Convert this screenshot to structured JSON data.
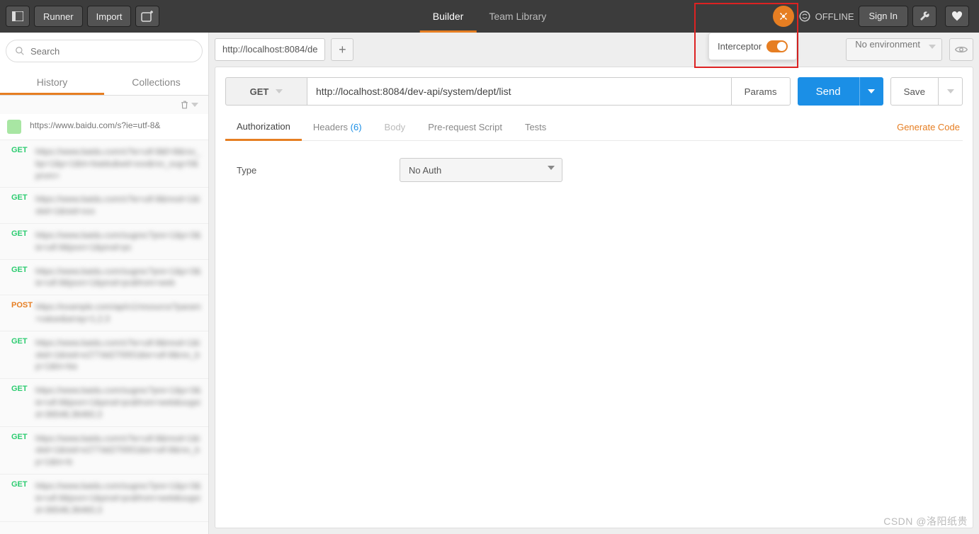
{
  "topbar": {
    "runner": "Runner",
    "import": "Import",
    "tabs": {
      "builder": "Builder",
      "teamlib": "Team Library"
    },
    "offline": "OFFLINE",
    "signin": "Sign In"
  },
  "popover": {
    "label": "Interceptor"
  },
  "sidebar": {
    "search_placeholder": "Search",
    "tabs": {
      "history": "History",
      "collections": "Collections"
    },
    "history": [
      {
        "method": "",
        "url": "https://www.baidu.com/s?ie=utf-8&"
      },
      {
        "method": "GET",
        "url": "https://www.baidu.com/s?ie=utf-8&f=8&rsv_bp=1&p=1&tn=baidu&wd=xxx&rsv_sug=0&prom="
      },
      {
        "method": "GET",
        "url": "https://www.baidu.com/s?ie=utf-8&mod=1&isbd=1&isid=xxx"
      },
      {
        "method": "GET",
        "url": "https://www.baidu.com/sugrec?pre=1&p=3&ie=utf-8&json=1&prod=pc"
      },
      {
        "method": "GET",
        "url": "https://www.baidu.com/sugrec?pre=1&p=3&ie=utf-8&json=1&prod=pc&from=web"
      },
      {
        "method": "POST",
        "url": "https://example.com/api/v1/resource?param=value&array=1,2,3"
      },
      {
        "method": "GET",
        "url": "https://www.baidu.com/s?ie=utf-8&mod=1&isbd=1&isid=e277dd270001&ie=utf-8&rsv_bp=1&tn=ba"
      },
      {
        "method": "GET",
        "url": "https://www.baidu.com/sugrec?pre=1&p=3&ie=utf-8&json=1&prod=pc&from=web&sugsid=36548,36460,3"
      },
      {
        "method": "GET",
        "url": "https://www.baidu.com/s?ie=utf-8&mod=1&isbd=1&isid=e277dd270001&ie=utf-8&rsv_bp=1&tn=b"
      },
      {
        "method": "GET",
        "url": "https://www.baidu.com/sugrec?pre=1&p=3&ie=utf-8&json=1&prod=pc&from=web&sugsid=36548,36460,3"
      }
    ]
  },
  "main": {
    "tab_label": "http://localhost:8084/de",
    "env_label": "No environment",
    "method": "GET",
    "url": "http://localhost:8084/dev-api/system/dept/list",
    "params": "Params",
    "send": "Send",
    "save": "Save",
    "req_tabs": {
      "authorization": "Authorization",
      "headers": "Headers",
      "headers_count": "(6)",
      "body": "Body",
      "prerequest": "Pre-request Script",
      "tests": "Tests"
    },
    "generate_code": "Generate Code",
    "auth": {
      "type_label": "Type",
      "value": "No Auth"
    }
  },
  "watermark": "CSDN @洛阳纸贵"
}
